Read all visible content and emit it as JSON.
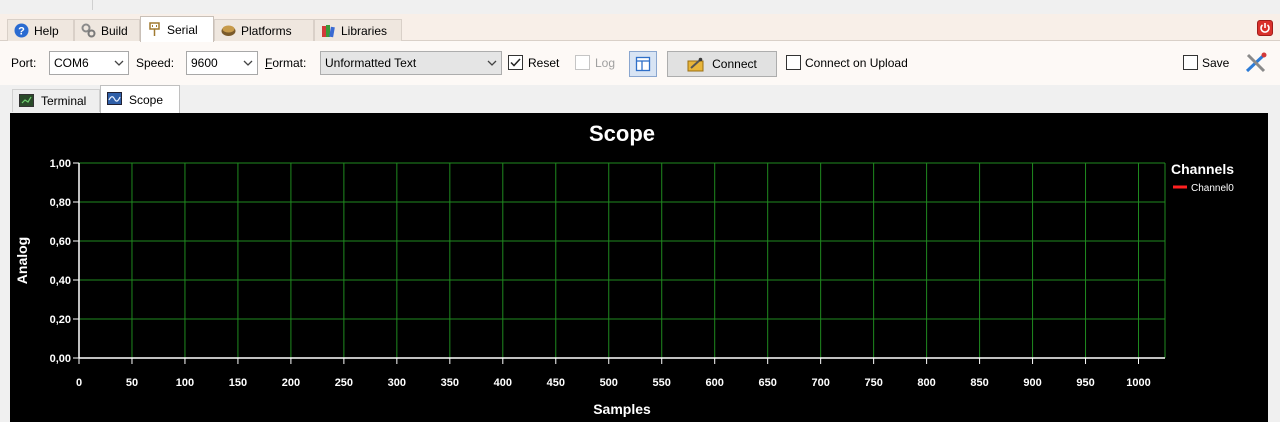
{
  "main_tabs": [
    {
      "label": "Help",
      "icon": "help-icon"
    },
    {
      "label": "Build",
      "icon": "gears-icon"
    },
    {
      "label": "Serial",
      "icon": "serial-plug-icon"
    },
    {
      "label": "Platforms",
      "icon": "box-icon"
    },
    {
      "label": "Libraries",
      "icon": "books-icon"
    }
  ],
  "active_main_tab": "Serial",
  "toolbar": {
    "port_label": "Port:",
    "port_value": "COM6",
    "speed_label": "Speed:",
    "speed_value": "9600",
    "format_label_first": "F",
    "format_label_rest": "ormat:",
    "format_value": "Unformatted Text",
    "reset_label": "Reset",
    "reset_checked": true,
    "log_label": "Log",
    "log_checked": false,
    "connect_label": "Connect",
    "connect_on_upload_label": "Connect on Upload",
    "connect_on_upload_checked": false,
    "save_label": "Save",
    "save_checked": false
  },
  "sub_tabs": [
    {
      "label": "Terminal",
      "icon": "terminal-icon"
    },
    {
      "label": "Scope",
      "icon": "scope-icon"
    }
  ],
  "active_sub_tab": "Scope",
  "colors": {
    "grid": "#1f8a1f",
    "axis": "#ffffff",
    "channel0": "#ff2020",
    "background": "#000000"
  },
  "chart_data": {
    "type": "line",
    "title": "Scope",
    "xlabel": "Samples",
    "ylabel": "Analog",
    "xlim": [
      0,
      1025
    ],
    "ylim": [
      0,
      1
    ],
    "x_ticks": [
      "0",
      "50",
      "100",
      "150",
      "200",
      "250",
      "300",
      "350",
      "400",
      "450",
      "500",
      "550",
      "600",
      "650",
      "700",
      "750",
      "800",
      "850",
      "900",
      "950",
      "1000"
    ],
    "y_ticks": [
      "0,00",
      "0,20",
      "0,40",
      "0,60",
      "0,80",
      "1,00"
    ],
    "grid": true,
    "legend": {
      "title": "Channels",
      "placement": "right"
    },
    "series": [
      {
        "name": "Channel0",
        "values": []
      }
    ]
  }
}
